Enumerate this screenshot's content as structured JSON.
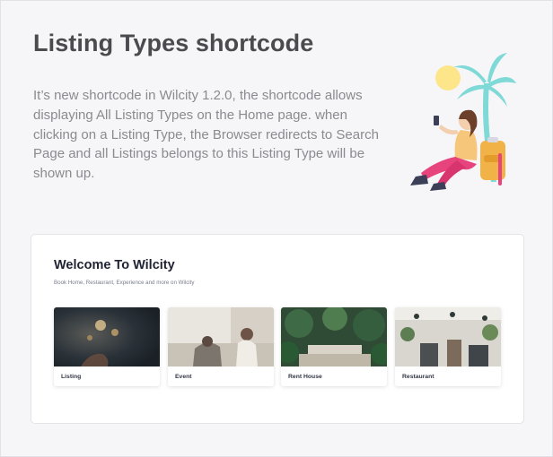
{
  "header": {
    "title": "Listing Types shortcode",
    "description": "It’s new shortcode in Wilcity 1.2.0, the shortcode allows displaying All Listing Types on the Home page. when clicking on a Listing Type, the Browser redirects to Search Page and all Listings belongs to this Listing Type will be shown up."
  },
  "preview": {
    "title": "Welcome To Wilcity",
    "subtitle": "Book Home, Restaurant, Experience and more on Wilcity",
    "cards": [
      {
        "label": "Listing"
      },
      {
        "label": "Event"
      },
      {
        "label": "Rent House"
      },
      {
        "label": "Restaurant"
      }
    ]
  },
  "colors": {
    "background": "#f6f6f8",
    "heading": "#4a4a4f",
    "text": "#8a8a90",
    "panel": "#ffffff",
    "palm": "#7fd9d6",
    "sun": "#fde58a",
    "person_pants": "#e7447d"
  },
  "illustration": {
    "icon": "beach-traveler-illustration"
  }
}
